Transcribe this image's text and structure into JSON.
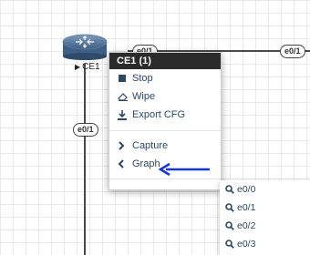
{
  "node": {
    "name": "CE1"
  },
  "links": {
    "top_left_iface": "e0/1",
    "top_right_iface": "e0/1",
    "left_iface": "e0/1"
  },
  "context_menu": {
    "title": "CE1 (1)",
    "items": [
      {
        "label": "Stop",
        "icon": "stop-icon"
      },
      {
        "label": "Wipe",
        "icon": "eraser-icon"
      },
      {
        "label": "Export CFG",
        "icon": "download-icon"
      }
    ],
    "items2": [
      {
        "label": "Capture",
        "icon": "chevron-right-icon"
      },
      {
        "label": "Graph",
        "icon": "chevron-left-icon"
      }
    ]
  },
  "submenu": {
    "items": [
      {
        "label": "e0/0",
        "icon": "search-icon"
      },
      {
        "label": "e0/1",
        "icon": "search-icon"
      },
      {
        "label": "e0/2",
        "icon": "search-icon"
      },
      {
        "label": "e0/3",
        "icon": "search-icon"
      }
    ]
  },
  "colors": {
    "menu_title_bg": "#2b2b2b",
    "menu_text": "#2c4766",
    "annotation_arrow": "#1432e6"
  }
}
